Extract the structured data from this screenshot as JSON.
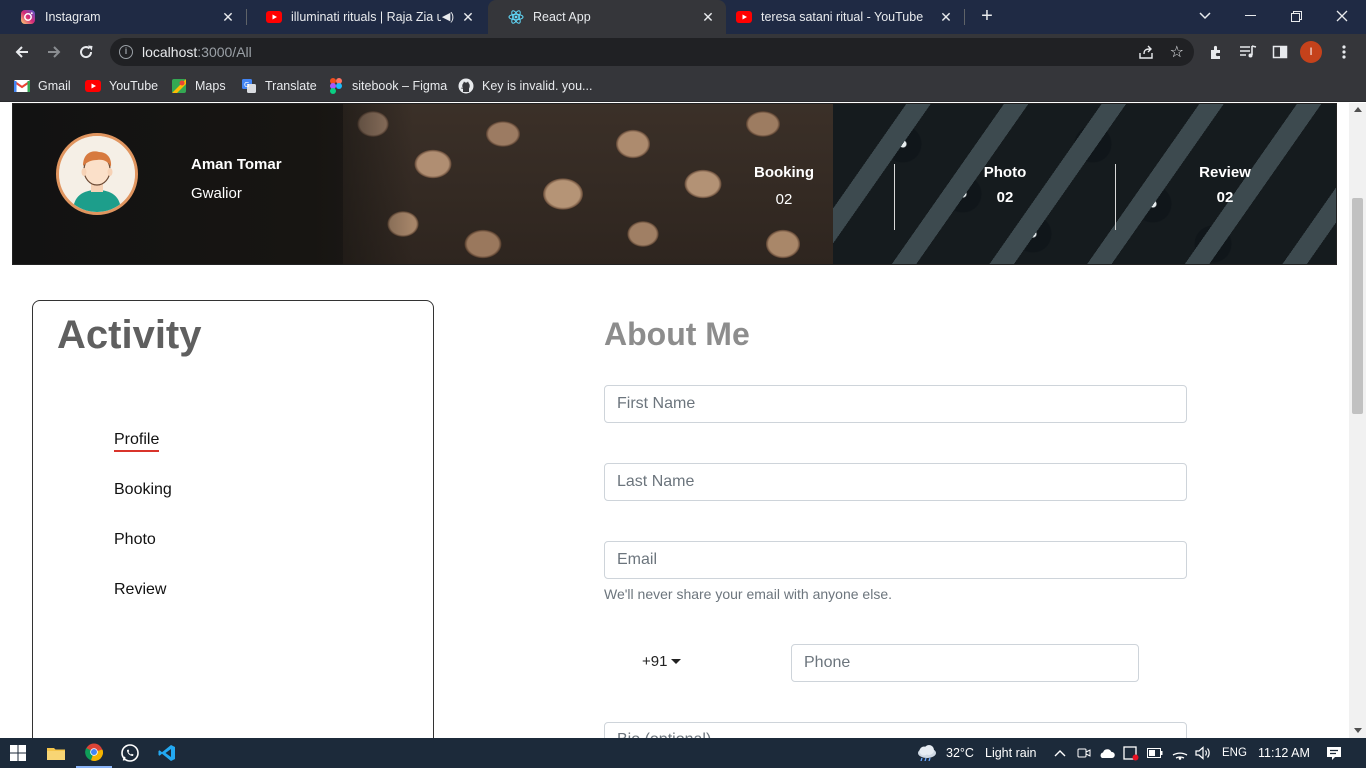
{
  "browser": {
    "tabs": [
      {
        "title": "Instagram",
        "icon": "instagram-icon"
      },
      {
        "title": "illuminati rituals | Raja Zia ul",
        "icon": "youtube-icon",
        "audio": true
      },
      {
        "title": "React App",
        "icon": "react-icon",
        "active": true
      },
      {
        "title": "teresa satani ritual - YouTube",
        "icon": "youtube-icon"
      }
    ],
    "url_host": "localhost",
    "url_path": ":3000/All",
    "profile_initial": "I",
    "bookmarks": [
      {
        "label": "Gmail",
        "icon": "gmail-icon"
      },
      {
        "label": "YouTube",
        "icon": "youtube-icon"
      },
      {
        "label": "Maps",
        "icon": "maps-icon"
      },
      {
        "label": "Translate",
        "icon": "translate-icon"
      },
      {
        "label": "sitebook – Figma",
        "icon": "figma-icon"
      },
      {
        "label": "Key is invalid. you...",
        "icon": "github-icon"
      }
    ]
  },
  "profile": {
    "name": "Aman Tomar",
    "city": "Gwalior",
    "stats": [
      {
        "label": "Booking",
        "value": "02"
      },
      {
        "label": "Photo",
        "value": "02"
      },
      {
        "label": "Review",
        "value": "02"
      }
    ]
  },
  "activity": {
    "title": "Activity",
    "items": [
      {
        "label": "Profile",
        "active": true
      },
      {
        "label": "Booking"
      },
      {
        "label": "Photo"
      },
      {
        "label": "Review"
      }
    ]
  },
  "about": {
    "title": "About Me",
    "first_name_placeholder": "First Name",
    "last_name_placeholder": "Last Name",
    "email_placeholder": "Email",
    "email_hint": "We'll never share your email with anyone else.",
    "country_code": "+91",
    "phone_placeholder": "Phone",
    "bio_placeholder": "Bio (optional)"
  },
  "taskbar": {
    "weather_temp": "32°C",
    "weather_desc": "Light rain",
    "language": "ENG",
    "time": "11:12 AM"
  },
  "colors": {
    "tab_strip": "#1f2a44",
    "toolbar": "#35363a",
    "accent_underline": "#d9342b",
    "heading_gray": "#5f5f5f",
    "taskbar": "#1c2a3a"
  }
}
